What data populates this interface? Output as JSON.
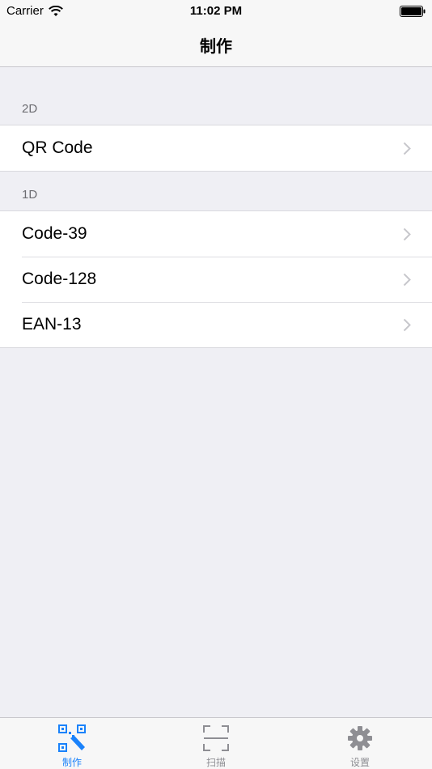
{
  "status_bar": {
    "carrier": "Carrier",
    "time": "11:02 PM",
    "wifi_icon": "wifi-icon",
    "battery_icon": "battery-icon"
  },
  "nav": {
    "title": "制作"
  },
  "sections": [
    {
      "header": "2D",
      "items": [
        {
          "label": "QR Code"
        }
      ]
    },
    {
      "header": "1D",
      "items": [
        {
          "label": "Code-39"
        },
        {
          "label": "Code-128"
        },
        {
          "label": "EAN-13"
        }
      ]
    }
  ],
  "tabs": [
    {
      "label": "制作",
      "icon": "qr-pencil-icon",
      "active": true
    },
    {
      "label": "扫描",
      "icon": "scan-frame-icon",
      "active": false
    },
    {
      "label": "设置",
      "icon": "gear-icon",
      "active": false
    }
  ],
  "colors": {
    "accent": "#1a82fb",
    "inactive": "#8e8e93",
    "background": "#efeff4"
  }
}
